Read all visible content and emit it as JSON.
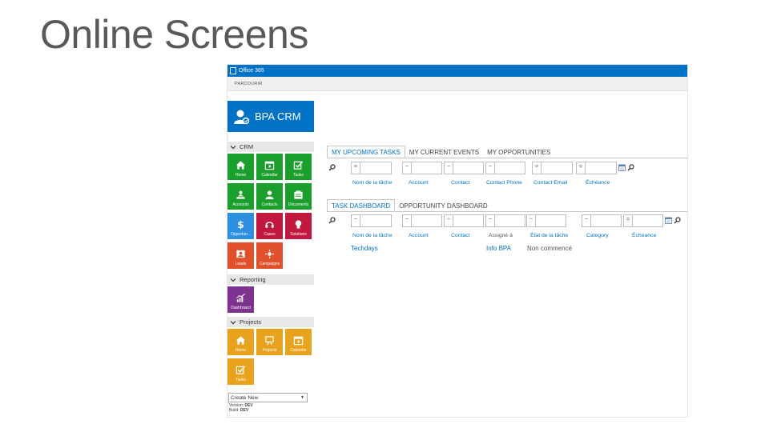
{
  "slide": {
    "title": "Online Screens"
  },
  "o365": {
    "brand": "Office 365"
  },
  "suite": {
    "browse_label": "PARCOURIR"
  },
  "app": {
    "name": "BPA CRM"
  },
  "nav": {
    "sections": [
      {
        "label": "CRM",
        "tiles": [
          {
            "label": "Home",
            "icon": "home-icon",
            "color": "#1a9f2c"
          },
          {
            "label": "Calendar",
            "icon": "calendar-icon",
            "color": "#1a9f2c"
          },
          {
            "label": "Tasks",
            "icon": "checkbox-icon",
            "color": "#1a9f2c"
          },
          {
            "label": "Accounts",
            "icon": "account-icon",
            "color": "#1a9f2c"
          },
          {
            "label": "Contacts",
            "icon": "person-icon",
            "color": "#1a9f2c"
          },
          {
            "label": "Documents",
            "icon": "documents-icon",
            "color": "#1a9f2c"
          },
          {
            "label": "Opportun...",
            "icon": "dollar-icon",
            "color": "#2d8fe0"
          },
          {
            "label": "Cases",
            "icon": "headset-icon",
            "color": "#c2183f"
          },
          {
            "label": "Solutions",
            "icon": "lightbulb-icon",
            "color": "#c2183f"
          },
          {
            "label": "Leads",
            "icon": "lead-icon",
            "color": "#e0502a"
          },
          {
            "label": "Campaigns",
            "icon": "target-icon",
            "color": "#e0502a"
          }
        ]
      },
      {
        "label": "Reporting",
        "tiles": [
          {
            "label": "Dashboard",
            "icon": "chart-icon",
            "color": "#7e338f"
          }
        ]
      },
      {
        "label": "Projects",
        "tiles": [
          {
            "label": "Home",
            "icon": "home-icon",
            "color": "#e8a21b"
          },
          {
            "label": "Projects",
            "icon": "easel-icon",
            "color": "#e8a21b"
          },
          {
            "label": "Calendar",
            "icon": "calendar-icon",
            "color": "#e8a21b"
          },
          {
            "label": "Tasks",
            "icon": "checkbox-icon",
            "color": "#e8a21b"
          }
        ]
      }
    ],
    "create_new": "Create New",
    "version_label": "Version:",
    "version_value": "DEV",
    "build_label": "Build:",
    "build_value": "DEV"
  },
  "upper": {
    "tabs": [
      "MY UPCOMING TASKS",
      "MY CURRENT EVENTS",
      "MY OPPORTUNITIES"
    ],
    "filter_ops": [
      "=",
      "~",
      "~",
      "~",
      "=",
      "="
    ],
    "columns": [
      "Nom de la tâche",
      "Account",
      "Contact",
      "Contact Phone",
      "Contact Email",
      "Échéance"
    ]
  },
  "lower": {
    "tabs": [
      "TASK DASHBOARD",
      "OPPORTUNITY DASHBOARD"
    ],
    "filter_ops": [
      "~",
      "~",
      "~",
      "~",
      "~",
      "~",
      "="
    ],
    "columns": [
      "Nom de la tâche",
      "Account",
      "Contact",
      "Assigné à",
      "État de la tâche",
      "Category",
      "Échéance"
    ],
    "rows": [
      {
        "task": "Techdays",
        "assigned": "Info BPA",
        "status": "Non commencé"
      }
    ]
  },
  "colors": {
    "accent": "#0072c6",
    "crm_green": "#1a9f2c",
    "cases_red": "#c2183f",
    "leads_orange": "#e0502a",
    "reporting_purple": "#7e338f",
    "projects_gold": "#e8a21b"
  }
}
